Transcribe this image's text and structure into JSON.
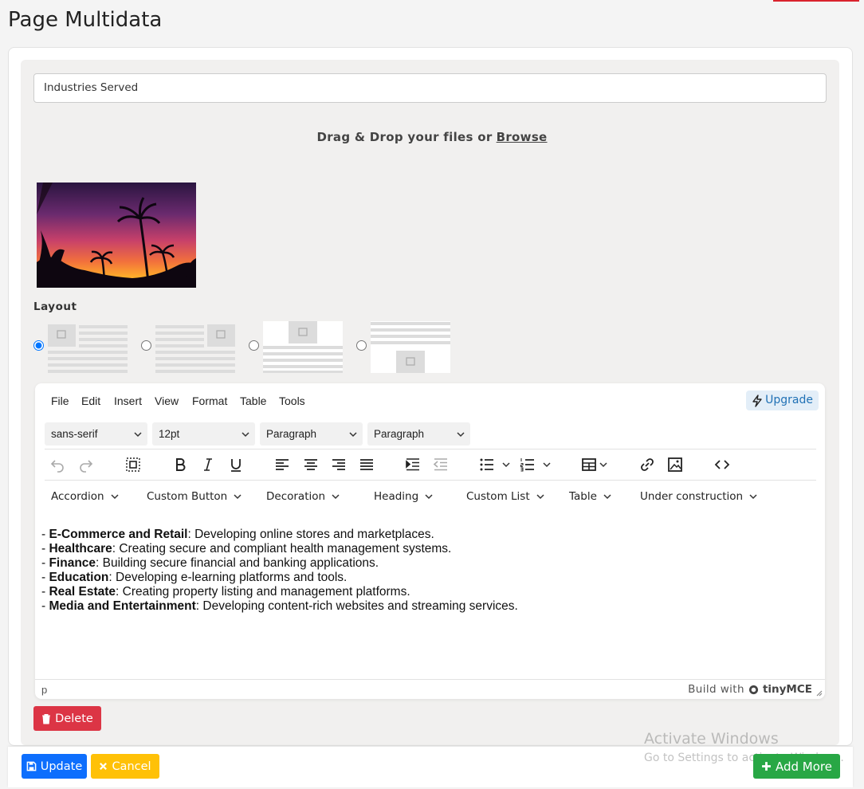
{
  "page": {
    "title": "Page Multidata"
  },
  "section": {
    "title_value": "Industries Served",
    "dropzone": {
      "text": "Drag & Drop your files or",
      "browse": "Browse"
    },
    "layout": {
      "label": "Layout",
      "options": [
        "image-left",
        "image-right",
        "image-top",
        "image-bottom"
      ],
      "selected": 0
    }
  },
  "editor": {
    "menu": [
      "File",
      "Edit",
      "Insert",
      "View",
      "Format",
      "Table",
      "Tools"
    ],
    "upgrade": "Upgrade",
    "font_family": "sans-serif",
    "font_size": "12pt",
    "block_format": "Paragraph",
    "block_format_2": "Paragraph",
    "toolbar_icons": [
      "undo-icon",
      "redo-icon",
      "select-all-icon",
      "bold-icon",
      "italic-icon",
      "underline-icon",
      "align-left-icon",
      "align-center-icon",
      "align-right-icon",
      "align-justify-icon",
      "indent-icon",
      "outdent-icon",
      "bullet-list-icon",
      "numbered-list-icon",
      "table-icon",
      "link-icon",
      "image-icon",
      "code-icon"
    ],
    "dropdowns": [
      "Accordion",
      "Custom Button",
      "Decoration",
      "Heading",
      "Custom List",
      "Table",
      "Under construction"
    ],
    "content": [
      {
        "bold": "E-Commerce and Retail",
        "text": ": Developing online stores and marketplaces."
      },
      {
        "bold": "Healthcare",
        "text": ": Creating secure and compliant health management systems."
      },
      {
        "bold": "Finance",
        "text": ": Building secure financial and banking applications."
      },
      {
        "bold": "Education",
        "text": ": Developing e-learning platforms and tools."
      },
      {
        "bold": "Real Estate",
        "text": ": Creating property listing and management platforms."
      },
      {
        "bold": "Media and Entertainment",
        "text": ": Developing content-rich websites and streaming services."
      }
    ],
    "status_path": "p",
    "build_with": "Build with",
    "brand": "tinyMCE"
  },
  "buttons": {
    "delete": "Delete",
    "update": "Update",
    "cancel": "Cancel",
    "add_more": "Add More"
  },
  "watermark": {
    "line1": "Activate Windows",
    "line2": "Go to Settings to activate Windows."
  },
  "colors": {
    "danger": "#dc3545",
    "primary": "#0d6efd",
    "warning": "#ffc107",
    "success": "#28a745",
    "upgrade_text": "#2071b5"
  }
}
